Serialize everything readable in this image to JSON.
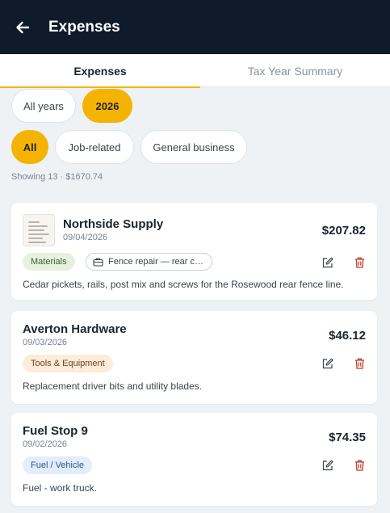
{
  "header": {
    "title": "Expenses",
    "back_icon": "arrow-left-icon"
  },
  "tabs": [
    {
      "label": "Expenses",
      "active": true
    },
    {
      "label": "Tax Year Summary",
      "active": false
    }
  ],
  "year_filters": [
    {
      "label": "All years",
      "selected": false
    },
    {
      "label": "2026",
      "selected": true
    }
  ],
  "type_filters": [
    {
      "label": "All",
      "selected": true
    },
    {
      "label": "Job-related",
      "selected": false
    },
    {
      "label": "General business",
      "selected": false
    }
  ],
  "summary": {
    "text": "Showing 13 · $1670.74"
  },
  "expenses": [
    {
      "vendor": "Northside Supply",
      "date": "09/04/2026",
      "amount": "$207.82",
      "category": "Materials",
      "job": "Fence repair — rear c…",
      "note": "Cedar pickets, rails, post mix and screws for the Rosewood rear fence line."
    },
    {
      "vendor": "Averton Hardware",
      "date": "09/03/2026",
      "amount": "$46.12",
      "category": "Tools & Equipment",
      "note": "Replacement driver bits and utility blades."
    },
    {
      "vendor": "Fuel Stop 9",
      "date": "09/02/2026",
      "amount": "$74.35",
      "category": "Fuel / Vehicle",
      "note": "Fuel - work truck."
    }
  ],
  "colors": {
    "header_bg": "#0f1b2b",
    "accent": "#f5b301",
    "delete": "#c0392b"
  }
}
